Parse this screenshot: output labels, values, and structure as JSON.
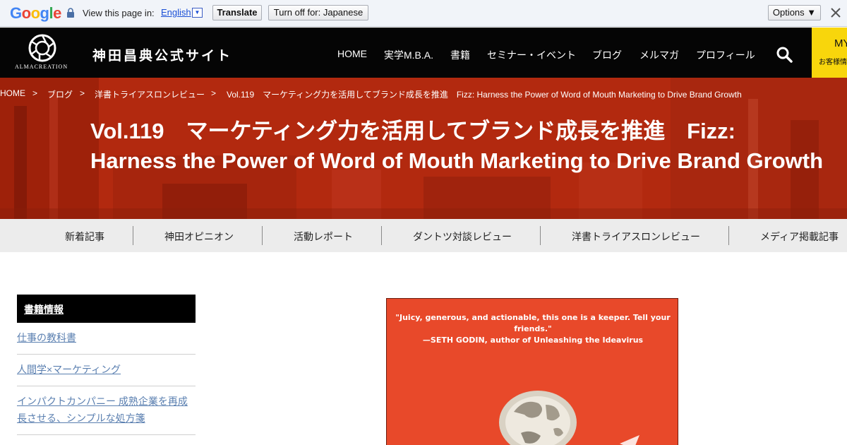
{
  "translate_bar": {
    "logo": "Google",
    "prompt": "View this page in:",
    "language": "English",
    "language_arrow": "▼",
    "translate_button": "Translate",
    "turn_off_button": "Turn off for: Japanese",
    "options_button": "Options ▼"
  },
  "header": {
    "logo_text": "ALMACREATION",
    "site_title": "神田昌典公式サイト",
    "nav": [
      "HOME",
      "実学M.B.A.",
      "書籍",
      "セミナー・イベント",
      "ブログ",
      "メルマガ",
      "プロフィール"
    ],
    "my_label": "MY",
    "my_sub": "お客様情報"
  },
  "breadcrumb": {
    "items": [
      "HOME",
      "ブログ",
      "洋書トライアスロンレビュー",
      "Vol.119　マーケティング力を活用してブランド成長を推進　Fizz: Harness the Power of Word of Mouth Marketing to Drive Brand Growth"
    ],
    "separator": ">"
  },
  "hero": {
    "title": "Vol.119　マーケティング力を活用してブランド成長を推進　Fizz: Harness the Power of Word of Mouth Marketing to Drive Brand Growth"
  },
  "categories": [
    "新着記事",
    "神田オピニオン",
    "活動レポート",
    "ダントツ対談レビュー",
    "洋書トライアスロンレビュー",
    "メディア掲載記事"
  ],
  "sidebar": {
    "heading": "書籍情報",
    "links": [
      "仕事の教科書",
      "人間学×マーケティング",
      "インパクトカンパニー 成熟企業を再成長させる、シンプルな処方箋"
    ]
  },
  "book": {
    "quote_line1": "\"Juicy, generous, and actionable, this one is a keeper. Tell your friends.\"",
    "quote_line2": "—SETH GODIN, author of Unleashing the Ideavirus"
  },
  "colors": {
    "hero_red": "#b2290f",
    "header_black": "#050505",
    "my_yellow": "#f8d60c",
    "link_blue": "#5a7fb0",
    "book_orange": "#e8492a"
  }
}
